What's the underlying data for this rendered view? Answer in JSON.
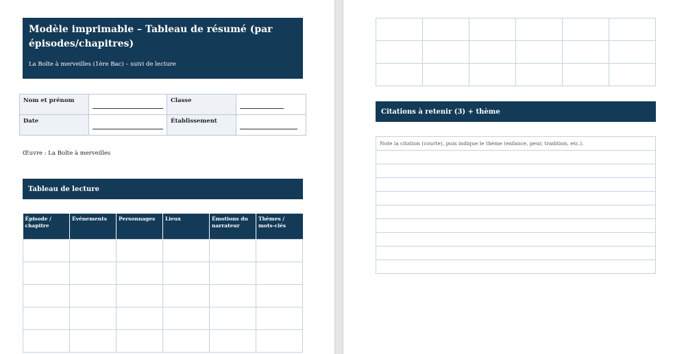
{
  "header": {
    "title": "Modèle imprimable – Tableau de résumé (par épisodes/chapitres)",
    "subtitle": "La Boîte à merveilles (1ère Bac) – suivi de lecture"
  },
  "info": {
    "name_label": "Nom et prénom",
    "class_label": "Classe",
    "date_label": "Date",
    "school_label": "Établissement"
  },
  "oeuvre": "Œuvre : La Boîte à merveilles",
  "reading": {
    "section_title": "Tableau de lecture",
    "columns": [
      "Épisode / chapitre",
      "Événements",
      "Personnages",
      "Lieux",
      "Émotions du narrateur",
      "Thèmes / mots-clés"
    ]
  },
  "citations": {
    "section_title": "Citations à retenir (3) + thème",
    "instruction": "Note la citation (courte), puis indique le thème (enfance, peur, tradition, etc.)."
  },
  "colors": {
    "banner": "#133a57",
    "border": "#c4d2e0",
    "label_bg": "#eef2f6"
  }
}
